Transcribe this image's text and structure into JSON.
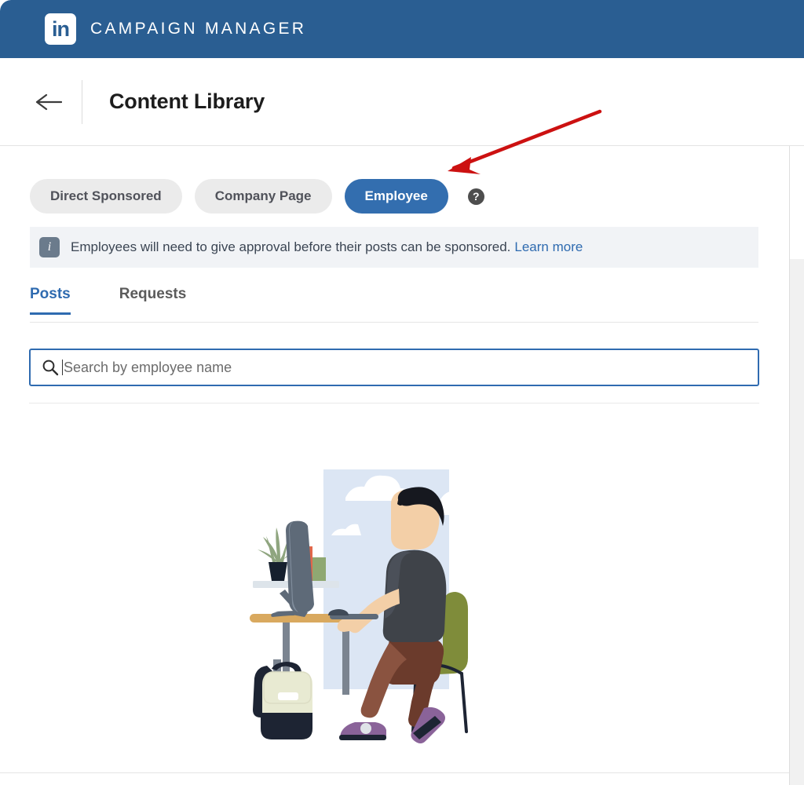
{
  "topbar": {
    "logo_icon": "linkedin-logo-icon",
    "logo_text": "in",
    "brand": "CAMPAIGN MANAGER",
    "background_color": "#2a5e92"
  },
  "page_header": {
    "back_icon": "arrow-left-icon",
    "title": "Content Library"
  },
  "filters": {
    "pills": [
      {
        "label": "Direct Sponsored",
        "active": false
      },
      {
        "label": "Company Page",
        "active": false
      },
      {
        "label": "Employee",
        "active": true
      }
    ],
    "help_icon": "question-mark-icon",
    "help_glyph": "?",
    "active_color": "#336eaf",
    "inactive_color": "#ebebeb"
  },
  "banner": {
    "icon": "info-icon",
    "icon_glyph": "i",
    "text": "Employees will need to give approval before their posts can be sponsored.",
    "link_label": "Learn more",
    "background_color": "#f1f3f6",
    "link_color": "#2f6bb0"
  },
  "tabs": [
    {
      "label": "Posts",
      "active": true
    },
    {
      "label": "Requests",
      "active": false
    }
  ],
  "search": {
    "icon": "search-icon",
    "placeholder": "Search by employee name",
    "value": "",
    "focused": true,
    "border_color": "#2f6bb0"
  },
  "illustration": {
    "name": "empty-state-illustration",
    "description": "Person working at a desk with a monitor, shelf with plant and books, backpack on the floor",
    "colors": {
      "sky": "#dce6f4",
      "cloud": "#ffffff",
      "desk": "#d9a95f",
      "desk_leg": "#7b8490",
      "monitor": "#5e6a78",
      "shirt": "#3f4349",
      "skin": "#f3cfa7",
      "hair": "#16181f",
      "pants": "#8a5340",
      "pants_dark": "#6b3b2c",
      "chair": "#7f8c3a",
      "chair_leg": "#1d2433",
      "shoe": "#8a6399",
      "backpack_top": "#e8ead2",
      "backpack_bottom": "#1d2433",
      "shelf": "#dde4ea",
      "plant": "#8fa57f",
      "pot": "#16202e",
      "book_olive": "#6e7553",
      "book_orange": "#e2674a",
      "book_green": "#8fa872"
    }
  },
  "annotation": {
    "arrow_icon": "red-arrow-annotation",
    "color": "#cc1111",
    "points_to": "Employee"
  }
}
